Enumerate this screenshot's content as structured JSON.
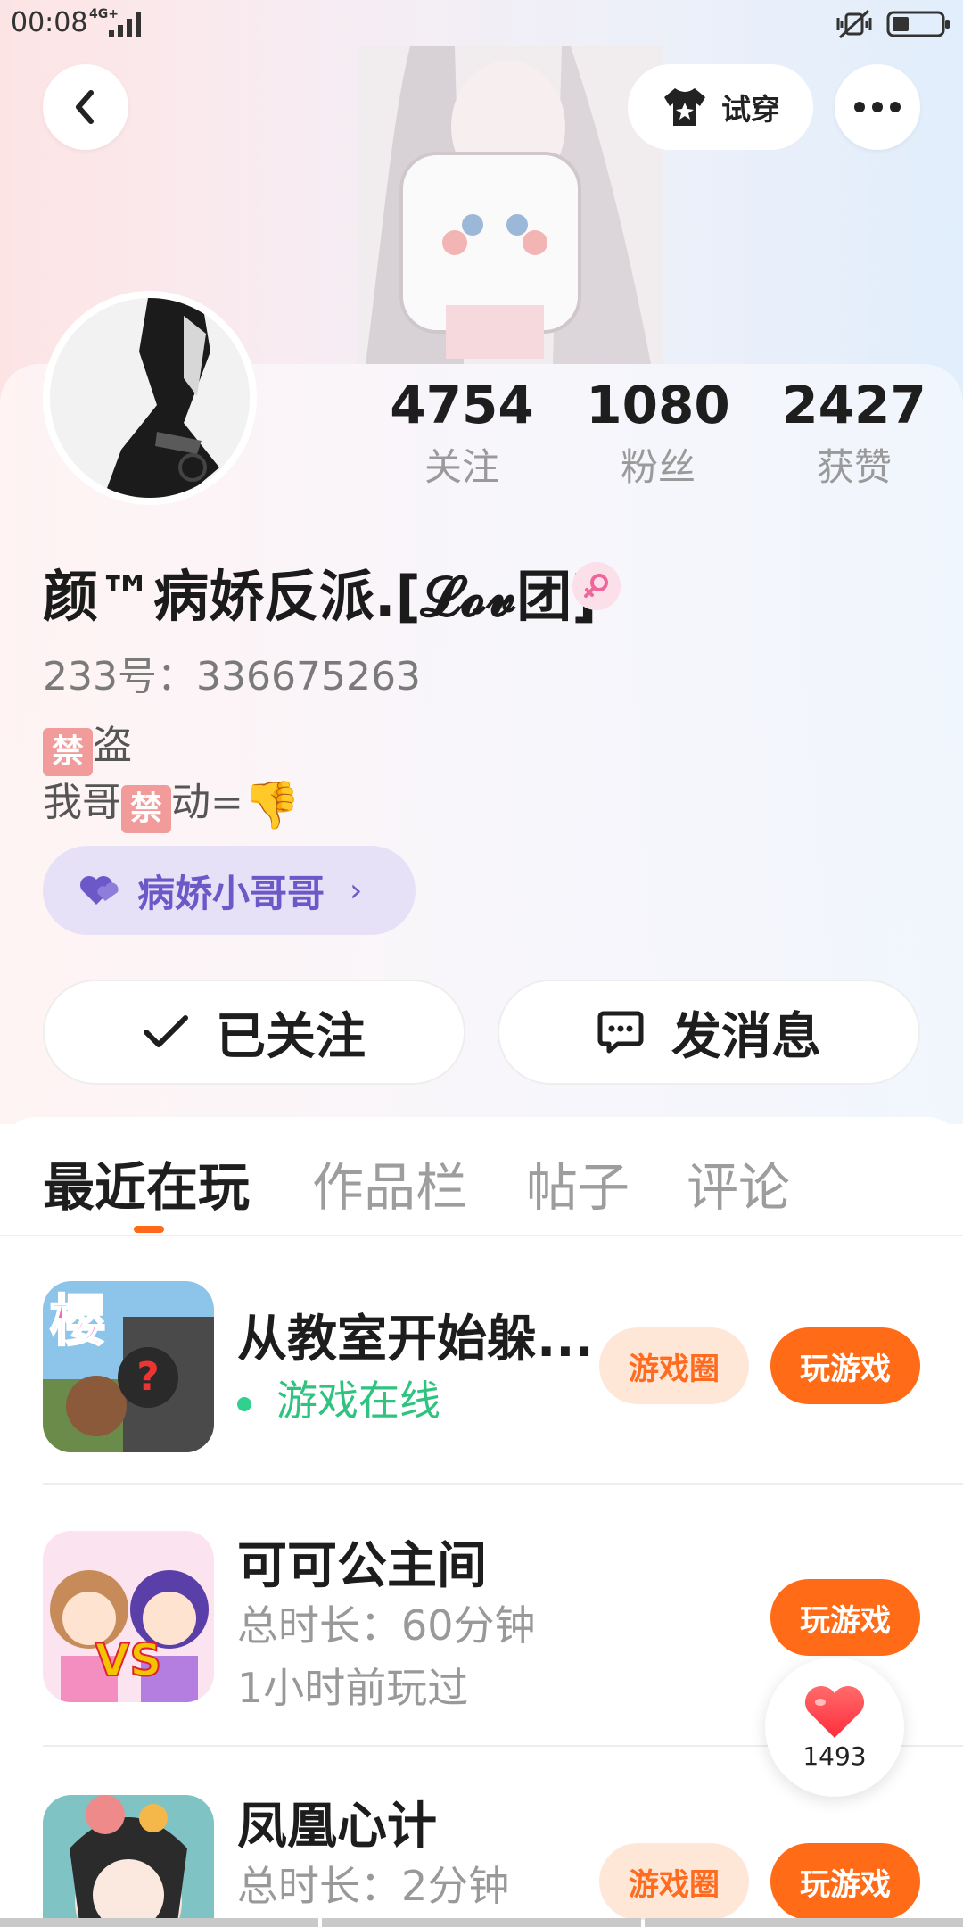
{
  "status_bar": {
    "time": "00:08",
    "network": "4G+"
  },
  "header": {
    "tryon_label": "试穿"
  },
  "profile": {
    "stats": [
      {
        "value": "4754",
        "label": "关注"
      },
      {
        "value": "1080",
        "label": "粉丝"
      },
      {
        "value": "2427",
        "label": "获赞"
      }
    ],
    "nickname": "颜™病娇反派.[𝓛𝓸𝓿团]",
    "user_id": "233号：336675263",
    "bio_line1_text": "盗",
    "bio_line2_prefix": "我哥",
    "bio_line2_suffix": "动=",
    "bio_ban_char": "禁",
    "bio_thumb_emoji": "👎",
    "tag_label": "病娇小哥哥",
    "tag_arrow": "›",
    "follow_label": "已关注",
    "message_label": "发消息"
  },
  "tabs": [
    {
      "label": "最近在玩",
      "active": true
    },
    {
      "label": "作品栏",
      "active": false
    },
    {
      "label": "帖子",
      "active": false
    },
    {
      "label": "评论",
      "active": false
    }
  ],
  "games": [
    {
      "title": "从教室开始躲...",
      "status": "游戏在线",
      "circle_label": "游戏圈",
      "play_label": "玩游戏"
    },
    {
      "title": "可可公主间",
      "duration": "总时长：60分钟",
      "last_played": "1小时前玩过",
      "play_label": "玩游戏"
    },
    {
      "title": "凤凰心计",
      "duration": "总时长：2分钟",
      "circle_label": "游戏圈",
      "play_label": "玩游戏"
    }
  ],
  "like": {
    "count": "1493"
  },
  "colors": {
    "accent": "#ff6b16",
    "tag_purple": "#6d58c8",
    "online_green": "#2fc37f"
  }
}
